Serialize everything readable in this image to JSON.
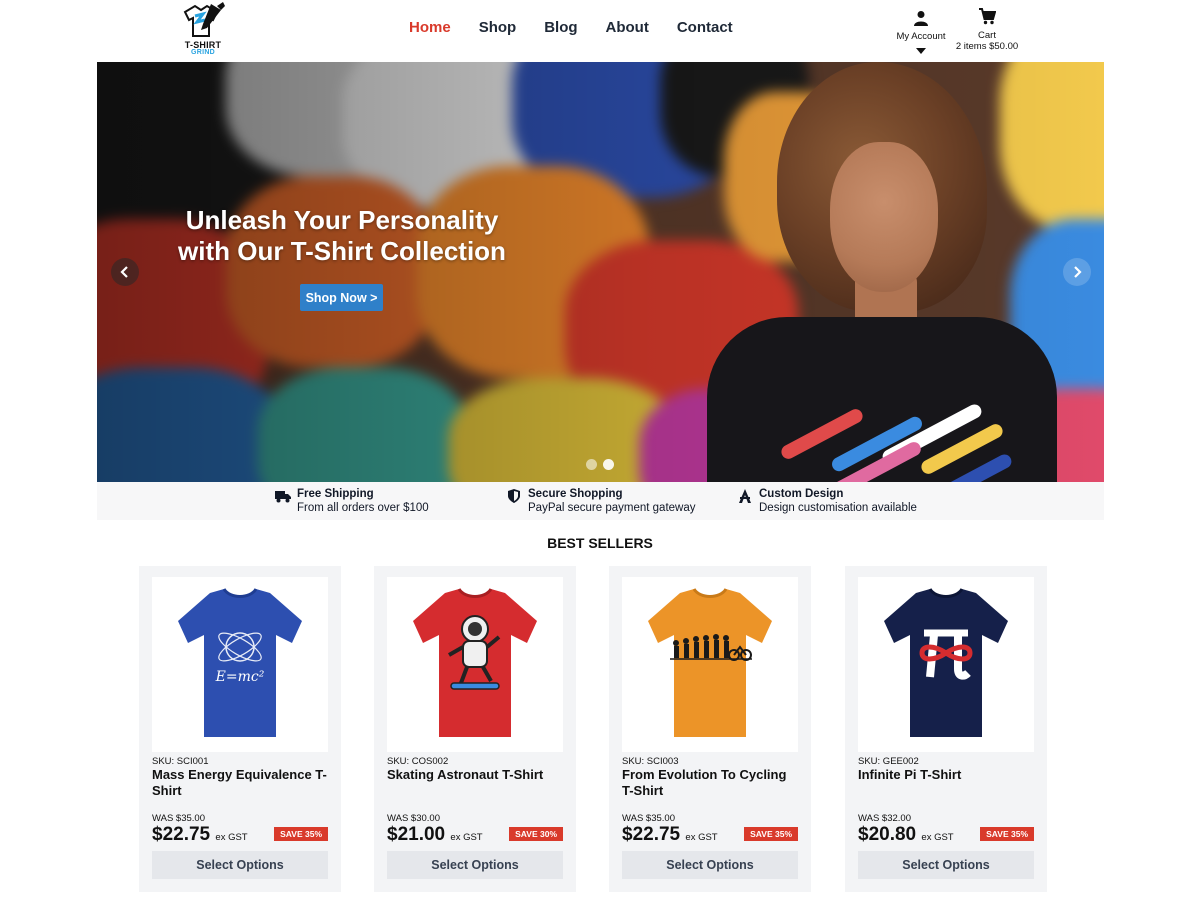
{
  "header": {
    "logo_line1": "T-SHIRT",
    "logo_line2": "GRIND",
    "nav": [
      "Home",
      "Shop",
      "Blog",
      "About",
      "Contact"
    ],
    "account_label": "My Account",
    "cart_label": "Cart",
    "cart_summary": "2 items $50.00"
  },
  "hero": {
    "title": "Unleash Your Personality with Our T-Shirt Collection",
    "button": "Shop Now >",
    "slides_total": 2,
    "active_slide": 2
  },
  "features": [
    {
      "icon": "truck-icon",
      "title": "Free Shipping",
      "text": "From all orders over $100"
    },
    {
      "icon": "shield-icon",
      "title": "Secure Shopping",
      "text": "PayPal secure payment gateway"
    },
    {
      "icon": "design-icon",
      "title": "Custom Design",
      "text": "Design customisation available"
    }
  ],
  "best_sellers": {
    "title": "BEST SELLERS",
    "products": [
      {
        "sku": "SKU:  SCI001",
        "name": "Mass Energy Equivalence T-Shirt",
        "was": "WAS $35.00",
        "price": "$22.75",
        "gst": "ex GST",
        "save": "SAVE 35%",
        "button": "Select Options",
        "shirt_color": "#2d4fb0",
        "print": "E=mc²"
      },
      {
        "sku": "SKU:  COS002",
        "name": "Skating Astronaut T-Shirt",
        "was": "WAS $30.00",
        "price": "$21.00",
        "gst": "ex GST",
        "save": "SAVE 30%",
        "button": "Select Options",
        "shirt_color": "#d52c2f",
        "print": "astronaut"
      },
      {
        "sku": "SKU:  SCI003",
        "name": "From Evolution To Cycling T-Shirt",
        "was": "WAS $35.00",
        "price": "$22.75",
        "gst": "ex GST",
        "save": "SAVE 35%",
        "button": "Select Options",
        "shirt_color": "#ec9428",
        "print": "evolution"
      },
      {
        "sku": "SKU:  GEE002",
        "name": "Infinite Pi T-Shirt",
        "was": "WAS $32.00",
        "price": "$20.80",
        "gst": "ex GST",
        "save": "SAVE 35%",
        "button": "Select Options",
        "shirt_color": "#15204a",
        "print": "π"
      }
    ]
  },
  "colors": {
    "accent": "#d93a2b",
    "button_blue": "#2f80c9"
  }
}
